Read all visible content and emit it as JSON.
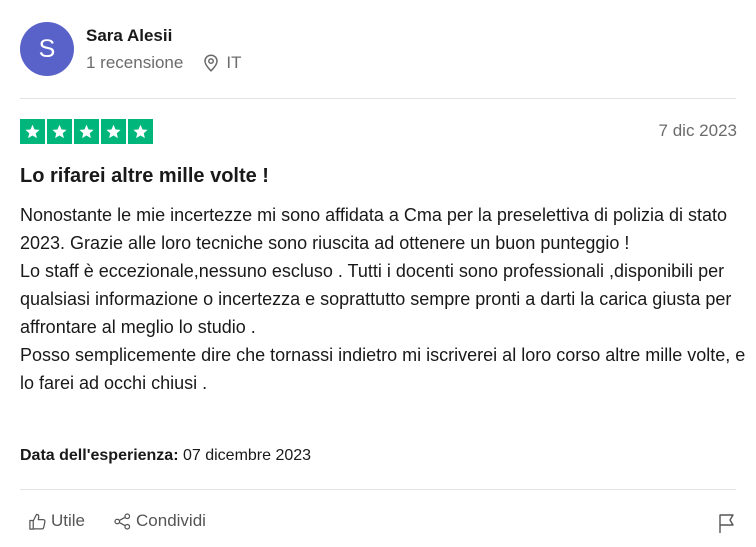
{
  "reviewer": {
    "initial": "S",
    "name": "Sara Alesii",
    "review_count": "1 recensione",
    "country": "IT",
    "avatar_color": "#5962c9"
  },
  "review": {
    "rating": 5,
    "max_rating": 5,
    "star_color": "#00b67a",
    "date": "7 dic 2023",
    "title": "Lo rifarei altre mille volte !",
    "body": "Nonostante le mie incertezze mi sono affidata a Cma per la preselettiva di polizia di stato 2023. Grazie alle loro tecniche sono riuscita ad ottenere un buon punteggio !\nLo staff è eccezionale,nessuno escluso . Tutti i docenti sono professionali ,disponibili per qualsiasi informazione o incertezza e soprattutto sempre pronti a darti la carica giusta per affrontare al meglio lo studio .\nPosso semplicemente dire che tornassi indietro mi iscriverei al loro corso altre mille volte, e lo farei ad occhi chiusi .",
    "experience_label": "Data dell'esperienza:",
    "experience_date": "07 dicembre 2023"
  },
  "actions": {
    "useful_label": "Utile",
    "useful_icon": "thumbs-up-icon",
    "share_label": "Condividi",
    "share_icon": "share-icon",
    "report_icon": "flag-icon"
  }
}
